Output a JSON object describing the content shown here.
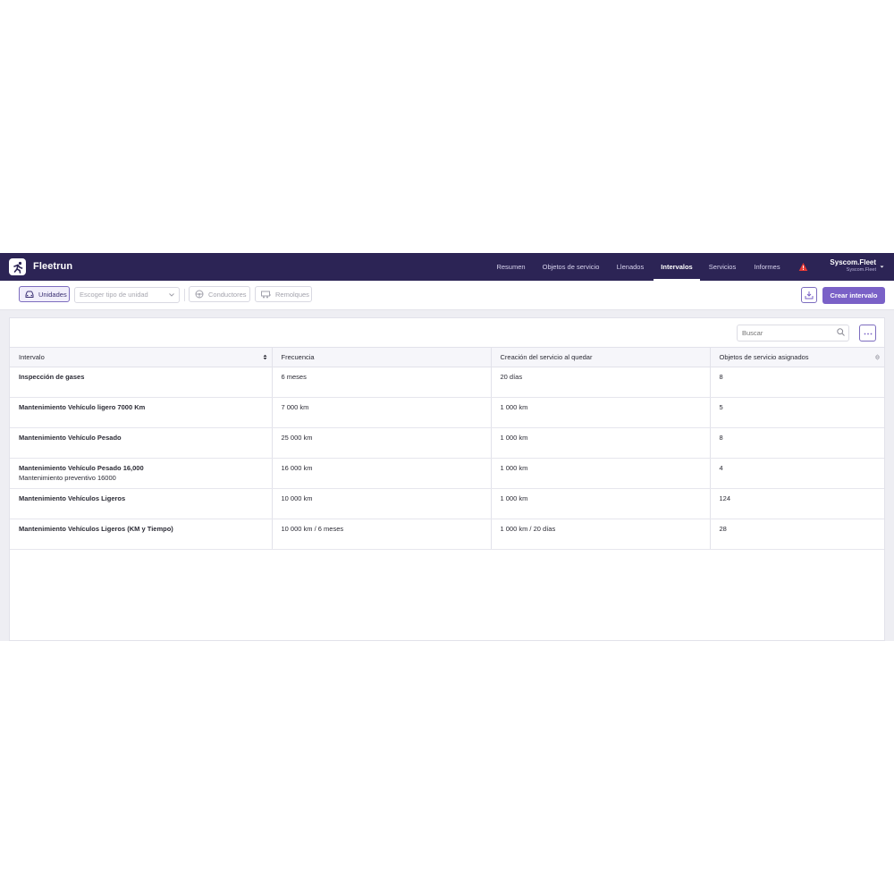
{
  "app": {
    "brand": "Fleetrun"
  },
  "nav": {
    "items": [
      {
        "label": "Resumen",
        "active": false
      },
      {
        "label": "Objetos de servicio",
        "active": false
      },
      {
        "label": "Llenados",
        "active": false
      },
      {
        "label": "Intervalos",
        "active": true
      },
      {
        "label": "Servicios",
        "active": false
      },
      {
        "label": "Informes",
        "active": false
      }
    ],
    "alert_icon": "alert-triangle-icon"
  },
  "user": {
    "name": "Syscom.Fleet",
    "account": "Syscom.Fleet"
  },
  "filters": {
    "units_label": "Unidades",
    "unit_type_placeholder": "Escoger tipo de unidad",
    "drivers_label": "Conductores",
    "trailers_label": "Remolques",
    "create_button": "Crear intervalo"
  },
  "search": {
    "placeholder": "Buscar"
  },
  "table": {
    "headers": [
      "Intervalo",
      "Frecuencia",
      "Creación del servicio al quedar",
      "Objetos de servicio asignados"
    ],
    "rows": [
      {
        "name": "Inspección de gases",
        "description": "",
        "frequency": "6 meses",
        "creation": "20 días",
        "assigned": "8"
      },
      {
        "name": "Mantenimiento Vehículo ligero 7000 Km",
        "description": "",
        "frequency": "7 000 km",
        "creation": "1 000 km",
        "assigned": "5"
      },
      {
        "name": "Mantenimiento Vehículo Pesado",
        "description": "",
        "frequency": "25 000 km",
        "creation": "1 000 km",
        "assigned": "8"
      },
      {
        "name": "Mantenimiento Vehículo Pesado 16,000",
        "description": "Mantenimiento preventivo 16000",
        "frequency": "16 000 km",
        "creation": "1 000 km",
        "assigned": "4"
      },
      {
        "name": "Mantenimiento Vehículos Ligeros",
        "description": "",
        "frequency": "10 000 km",
        "creation": "1 000 km",
        "assigned": "124"
      },
      {
        "name": "Mantenimiento Vehículos Ligeros (KM y Tiempo)",
        "description": "",
        "frequency": "10 000 km / 6 meses",
        "creation": "1 000 km / 20 días",
        "assigned": "28"
      }
    ]
  },
  "colors": {
    "topbar": "#2c2455",
    "accent": "#7a61c7",
    "alert": "#e53935"
  }
}
